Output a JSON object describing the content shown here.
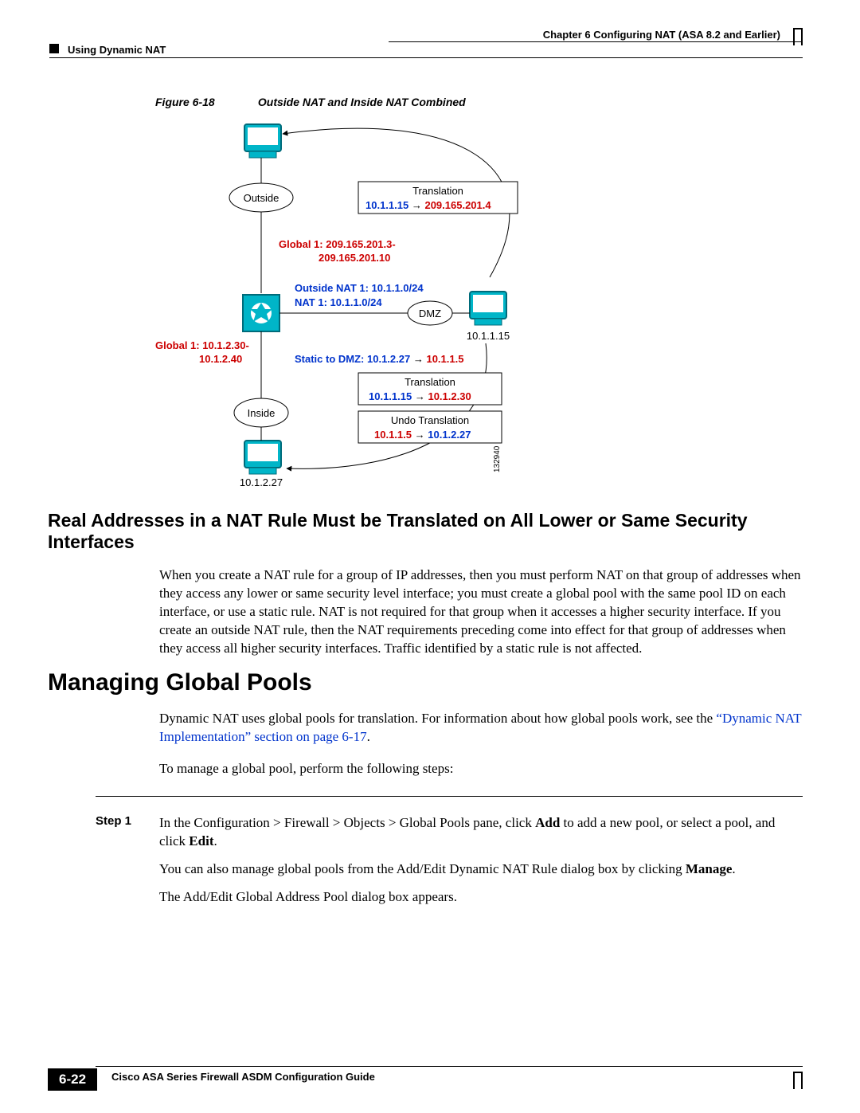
{
  "header": {
    "chapter": "Chapter 6      Configuring NAT (ASA 8.2 and Earlier)",
    "section": "Using Dynamic NAT"
  },
  "figure": {
    "num": "Figure 6-18",
    "title": "Outside NAT and Inside NAT Combined",
    "labels": {
      "outside": "Outside",
      "inside": "Inside",
      "dmz": "DMZ",
      "transl": "Translation",
      "undo": "Undo Translation",
      "ip_dmz": "10.1.1.15",
      "ip_inside": "10.1.2.27",
      "image_id": "132940",
      "t1a": "10.1.1.15",
      "t1b": "209.165.201.4",
      "g1a": "Global 1: 209.165.201.3-",
      "g1b": "209.165.201.10",
      "on1": "Outside NAT 1: 10.1.1.0/24",
      "n1": "NAT 1: 10.1.1.0/24",
      "g2a": "Global 1: 10.1.2.30-",
      "g2b": "10.1.2.40",
      "static1": "Static to DMZ: 10.1.2.27",
      "static1b": "10.1.1.5",
      "t2a": "10.1.1.15",
      "t2b": "10.1.2.30",
      "u1a": "10.1.1.5",
      "u1b": "10.1.2.27"
    }
  },
  "sec1": {
    "title": "Real Addresses in a NAT Rule Must be Translated on All Lower or Same Security Interfaces",
    "para": "When you create a NAT rule for a group of IP addresses, then you must perform NAT on that group of addresses when they access any lower or same security level interface; you must create a global pool with the same pool ID on each interface, or use a static rule. NAT is not required for that group when it accesses a higher security interface. If you create an outside NAT rule, then the NAT requirements preceding come into effect for that group of addresses when they access all higher security interfaces. Traffic identified by a static rule is not affected."
  },
  "sec2": {
    "title": "Managing Global Pools",
    "p1a": "Dynamic NAT uses global pools for translation. For information about how global pools work, see the ",
    "p1link": "“Dynamic NAT Implementation” section on page 6-17",
    "p1b": ".",
    "p2": "To manage a global pool, perform the following steps:",
    "step1_label": "Step 1",
    "step1_a": "In the Configuration > Firewall > Objects > Global Pools pane, click ",
    "step1_add": "Add",
    "step1_b": " to add a new pool, or select a pool, and click ",
    "step1_edit": "Edit",
    "step1_c": ".",
    "step1_p2a": "You can also manage global pools from the Add/Edit Dynamic NAT Rule dialog box by clicking ",
    "step1_manage": "Manage",
    "step1_p2b": ".",
    "step1_p3": "The Add/Edit Global Address Pool dialog box appears."
  },
  "footer": {
    "guide": "Cisco ASA Series Firewall ASDM Configuration Guide",
    "page": "6-22"
  }
}
